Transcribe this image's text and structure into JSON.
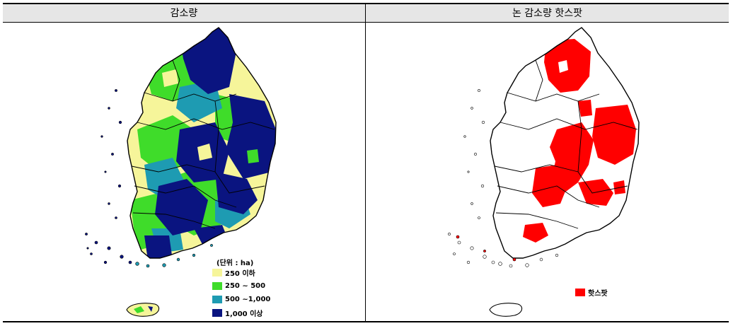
{
  "table": {
    "headers": [
      "감소량",
      "논 감소량 핫스팟"
    ]
  },
  "left_map": {
    "legend": {
      "title": "(단위 : ha)",
      "items": [
        {
          "label": "250 이하",
          "color": "#f6f59a"
        },
        {
          "label": "250 ~ 500",
          "color": "#3fdc2a"
        },
        {
          "label": "500 ~1,000",
          "color": "#1e9bb2"
        },
        {
          "label": "1,000 이상",
          "color": "#0a1480"
        }
      ]
    }
  },
  "right_map": {
    "legend": {
      "items": [
        {
          "label": "핫스팟",
          "color": "#ff0000"
        }
      ]
    }
  }
}
